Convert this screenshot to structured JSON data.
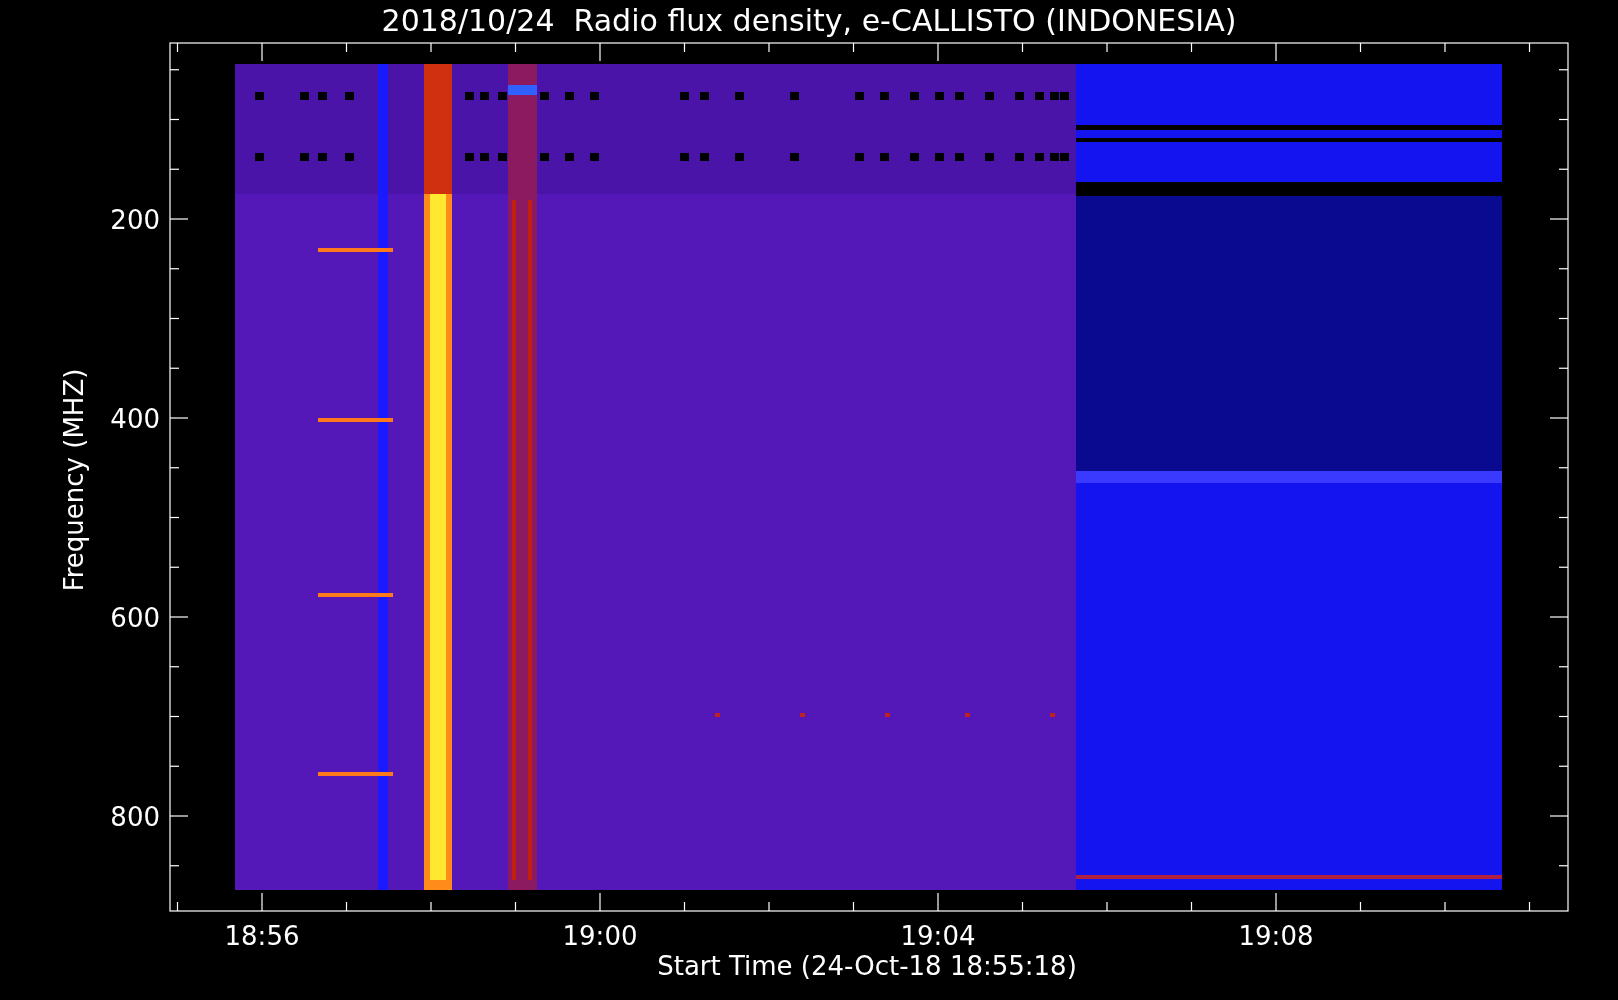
{
  "title": "2018/10/24  Radio flux density, e-CALLISTO (INDONESIA)",
  "y_axis": {
    "label": "Frequency (MHZ)",
    "ticks": [
      "200",
      "400",
      "600",
      "800"
    ]
  },
  "x_axis": {
    "label": "Start Time (24-Oct-18 18:55:18)",
    "ticks": [
      "18:56",
      "19:00",
      "19:04",
      "19:08"
    ]
  }
}
